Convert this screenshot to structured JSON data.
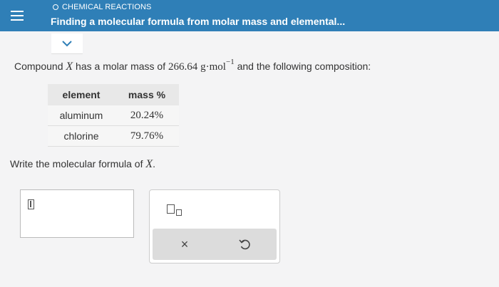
{
  "header": {
    "section": "CHEMICAL REACTIONS",
    "title": "Finding a molecular formula from molar mass and elemental..."
  },
  "question": {
    "part1": "Compound ",
    "var": "X",
    "part2": " has a molar mass of ",
    "mass_value": "266.64",
    "unit_g": "g",
    "unit_dot": "·",
    "unit_mol": "mol",
    "unit_exp": "−1",
    "part3": " and the following composition:"
  },
  "table": {
    "headers": [
      "element",
      "mass %"
    ],
    "rows": [
      [
        "aluminum",
        "20.24%"
      ],
      [
        "chlorine",
        "79.76%"
      ]
    ]
  },
  "prompt": {
    "text": "Write the molecular formula of ",
    "var": "X",
    "end": "."
  },
  "icons": {
    "menu": "hamburger-icon",
    "collapse": "chevron-down-icon",
    "cursor": "text-cursor-icon",
    "subscript": "subscript-template-icon",
    "clear": "close-icon",
    "undo": "undo-icon"
  },
  "toolbar": {
    "clear_glyph": "×"
  },
  "colors": {
    "header_bg": "#2f7fb7",
    "page_bg": "#f4f4f5"
  }
}
